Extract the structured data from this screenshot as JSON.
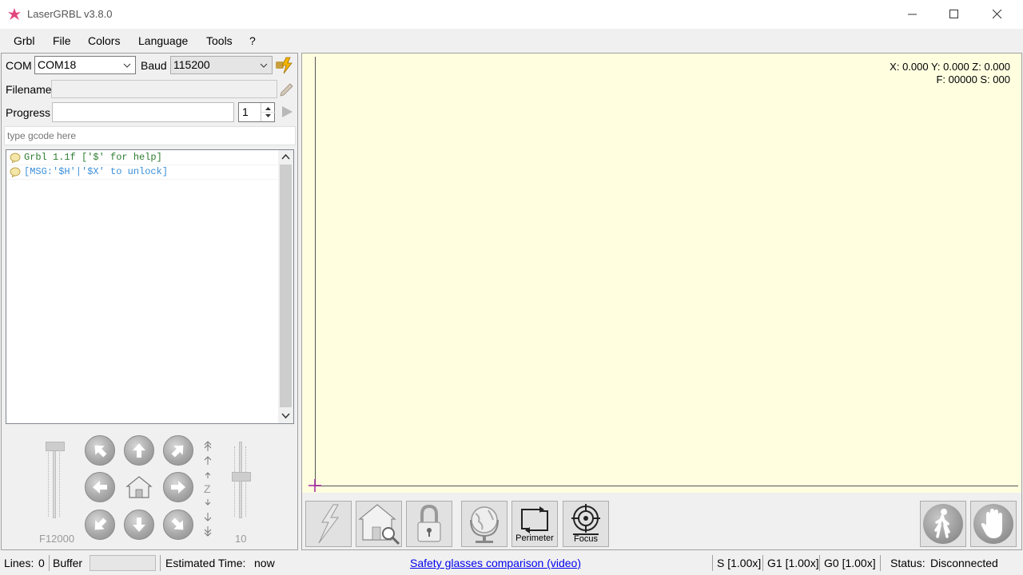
{
  "window": {
    "title": "LaserGRBL v3.8.0"
  },
  "menu": [
    "Grbl",
    "File",
    "Colors",
    "Language",
    "Tools",
    "?"
  ],
  "connection": {
    "com_label": "COM",
    "com_value": "COM18",
    "baud_label": "Baud",
    "baud_value": "115200"
  },
  "file": {
    "filename_label": "Filename",
    "filename_value": ""
  },
  "progress": {
    "label": "Progress",
    "copies": "1",
    "fraction": 0
  },
  "gcode_input": {
    "placeholder": "type gcode here"
  },
  "console": {
    "lines": [
      {
        "text": "Grbl 1.1f ['$' for help]",
        "color": "#2e7d32"
      },
      {
        "text": "[MSG:'$H'|'$X' to unlock]",
        "color": "#3c8fd8"
      }
    ]
  },
  "jog": {
    "feed_label": "F12000",
    "step_label": "10",
    "z_label": "Z",
    "feed_slider_fraction": 1.0,
    "step_slider_fraction": 0.55
  },
  "canvas": {
    "coords_line1": "X: 0.000 Y: 0.000 Z: 0.000",
    "coords_line2": "F: 00000 S: 000",
    "background": "#ffffe0"
  },
  "toolbar": {
    "perimeter_label": "Perimeter",
    "focus_label": "Focus"
  },
  "status": {
    "lines_label": "Lines:",
    "lines_value": "0",
    "buffer_label": "Buffer",
    "estimated_label": "Estimated Time:",
    "estimated_value": "now",
    "link_text": "Safety glasses comparison (video)",
    "s_override": "S [1.00x]",
    "g1_override": "G1 [1.00x]",
    "g0_override": "G0 [1.00x]",
    "status_label": "Status:",
    "status_value": "Disconnected"
  },
  "colors": {
    "accent_link": "#0000ee",
    "canvas_bg": "#ffffe0",
    "origin_marker": "#a020a0"
  }
}
